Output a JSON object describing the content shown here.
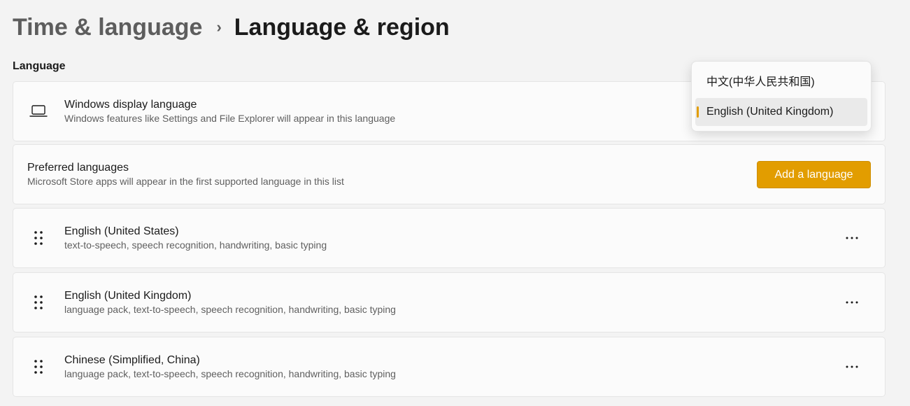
{
  "breadcrumb": {
    "parent": "Time & language",
    "separator": "›",
    "current": "Language & region"
  },
  "section": {
    "title": "Language"
  },
  "display_language": {
    "icon": "laptop-icon",
    "title": "Windows display language",
    "subtitle": "Windows features like Settings and File Explorer will appear in this language"
  },
  "display_language_dropdown": {
    "options": [
      "中文(中华人民共和国)",
      "English (United Kingdom)"
    ],
    "selected": "English (United Kingdom)"
  },
  "preferred_languages": {
    "title": "Preferred languages",
    "subtitle": "Microsoft Store apps will appear in the first supported language in this list",
    "add_button_label": "Add a language"
  },
  "languages": [
    {
      "name": "English (United States)",
      "features": "text-to-speech, speech recognition, handwriting, basic typing"
    },
    {
      "name": "English (United Kingdom)",
      "features": "language pack, text-to-speech, speech recognition, handwriting, basic typing"
    },
    {
      "name": "Chinese (Simplified, China)",
      "features": "language pack, text-to-speech, speech recognition, handwriting, basic typing"
    }
  ],
  "colors": {
    "accent": "#e29d00",
    "background": "#f3f3f3",
    "card": "#fbfbfb"
  }
}
